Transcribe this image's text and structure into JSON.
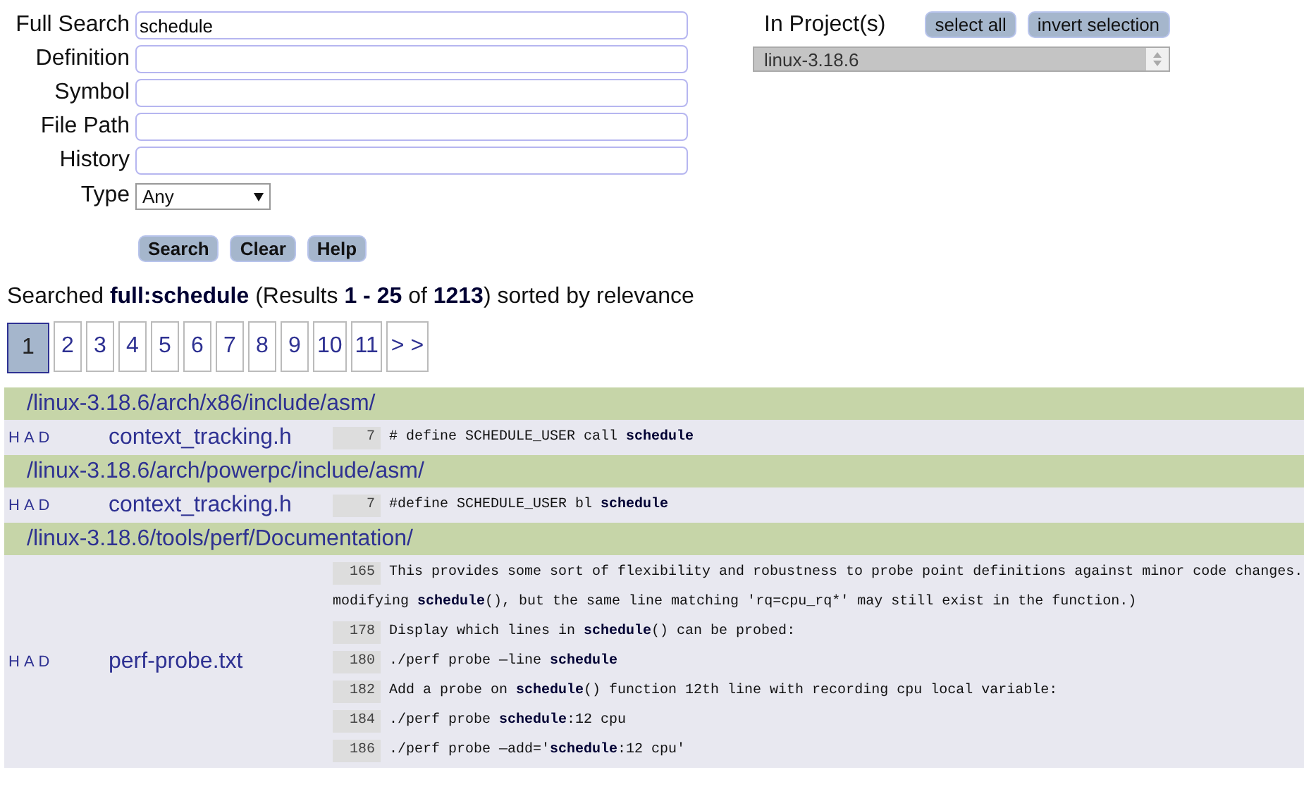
{
  "search_form": {
    "fields": [
      {
        "label": "Full Search",
        "value": "schedule"
      },
      {
        "label": "Definition"
      },
      {
        "label": "Symbol"
      },
      {
        "label": "File Path"
      },
      {
        "label": "History"
      }
    ],
    "type_select": {
      "label": "Type",
      "value": "Any"
    },
    "buttons": [
      "Search",
      "Clear",
      "Help"
    ]
  },
  "projects": {
    "label": "In Project(s)",
    "buttons": [
      "select all",
      "invert selection"
    ],
    "items": [
      {
        "name": "linux-3.18.6",
        "selected": true
      }
    ]
  },
  "results_summary": "Searched **full:schedule** (Results **1 - 25** of **1213**) sorted by relevance",
  "pagination": [
    {
      "label": "1",
      "selected": true
    },
    {
      "label": "2",
      "selected": false
    },
    {
      "label": "3",
      "selected": false
    },
    {
      "label": "4",
      "selected": false
    },
    {
      "label": "5",
      "selected": false
    },
    {
      "label": "6",
      "selected": false
    },
    {
      "label": "7",
      "selected": false
    },
    {
      "label": "8",
      "selected": false
    },
    {
      "label": "9",
      "selected": false
    },
    {
      "label": "10",
      "selected": false
    },
    {
      "label": "11",
      "selected": false
    },
    {
      "label": "> >",
      "selected": false
    }
  ],
  "results": [
    {
      "directory": "/linux-3.18.6/arch/x86/include/asm/",
      "files": [
        {
          "links": [
            "H",
            "A",
            "D"
          ],
          "name": "context_tracking.h",
          "lines": [
            {
              "number": "7",
              "code": "# define SCHEDULE_USER call **schedule**"
            }
          ]
        }
      ]
    },
    {
      "directory": "/linux-3.18.6/arch/powerpc/include/asm/",
      "files": [
        {
          "links": [
            "H",
            "A",
            "D"
          ],
          "name": "context_tracking.h",
          "lines": [
            {
              "number": "7",
              "code": "#define SCHEDULE_USER bl **schedule**"
            }
          ]
        }
      ]
    },
    {
      "directory": "/linux-3.18.6/tools/perf/Documentation/",
      "files": [
        {
          "links": [
            "H",
            "A",
            "D"
          ],
          "name": "perf-probe.txt",
          "lines": [
            {
              "number": "165",
              "code": "This provides some sort of flexibility and robustness to probe point definitions against minor code changes."
            },
            {
              "code": "modifying **schedule**(), but the same line matching 'rq=cpu_rq*' may still exist in the function.)"
            },
            {
              "number": "178",
              "code": "Display which lines in **schedule**() can be probed:"
            },
            {
              "number": "180",
              "code": "./perf probe —line **schedule**"
            },
            {
              "number": "182",
              "code": "Add a probe on **schedule**() function 12th line with recording cpu local variable:"
            },
            {
              "number": "184",
              "code": "./perf probe **schedule**:12 cpu"
            },
            {
              "number": "186",
              "code": "./perf probe —add='**schedule**:12 cpu'"
            }
          ]
        }
      ]
    }
  ]
}
